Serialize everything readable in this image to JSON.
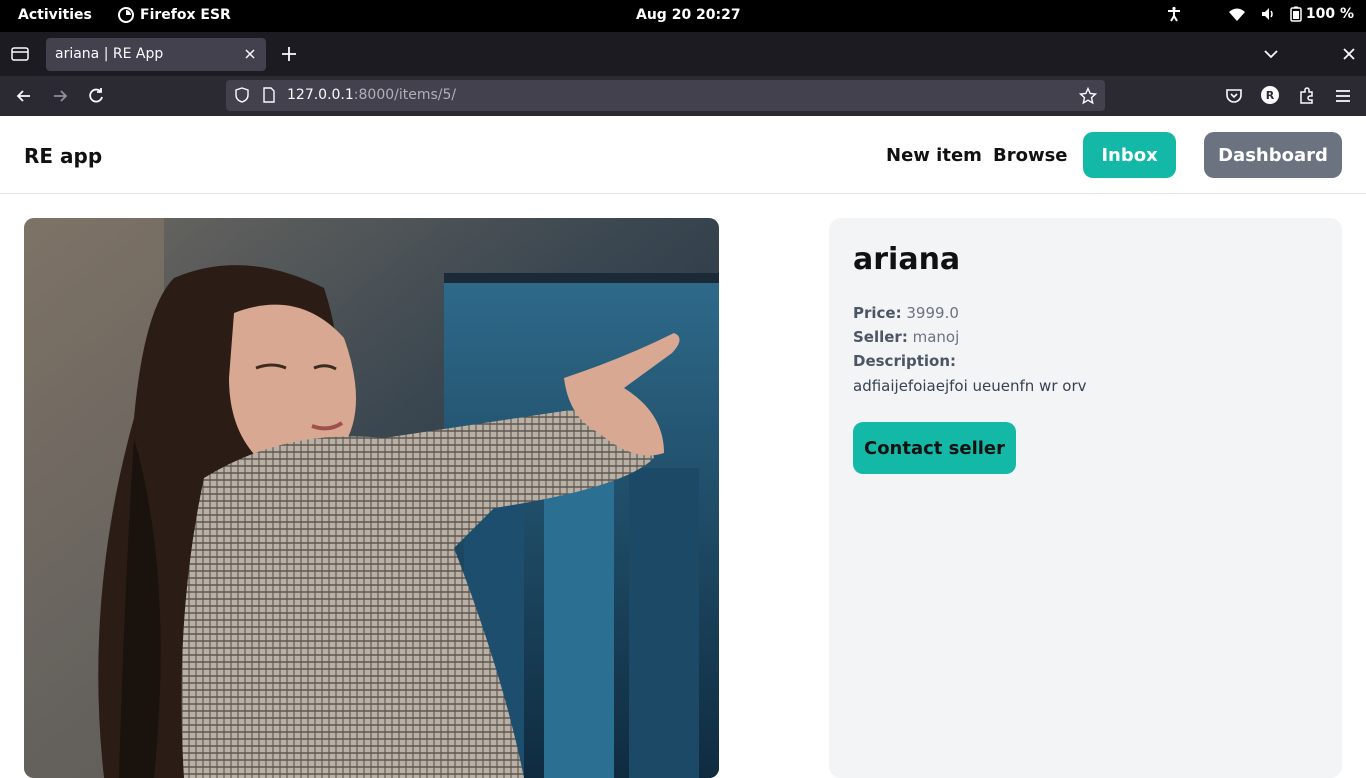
{
  "system_bar": {
    "activities": "Activities",
    "app_name": "Firefox ESR",
    "clock": "Aug 20  20:27",
    "battery": "100 %"
  },
  "browser": {
    "tab_title": "ariana | RE App",
    "url_host": "127.0.0.1",
    "url_rest": ":8000/items/5/",
    "profile_initial": "R"
  },
  "site": {
    "brand": "RE app",
    "nav": {
      "new_item": "New item",
      "browse": "Browse",
      "inbox": "Inbox",
      "dashboard": "Dashboard"
    }
  },
  "item": {
    "name": "ariana",
    "price_label": "Price:",
    "price": "3999.0",
    "seller_label": "Seller:",
    "seller": "manoj",
    "description_label": "Description:",
    "description": "adfiaijefoiaejfoi ueuenfn wr orv",
    "contact_button": "Contact seller"
  },
  "colors": {
    "accent_teal": "#14b8a6",
    "dashboard_gray": "#6b7280"
  }
}
